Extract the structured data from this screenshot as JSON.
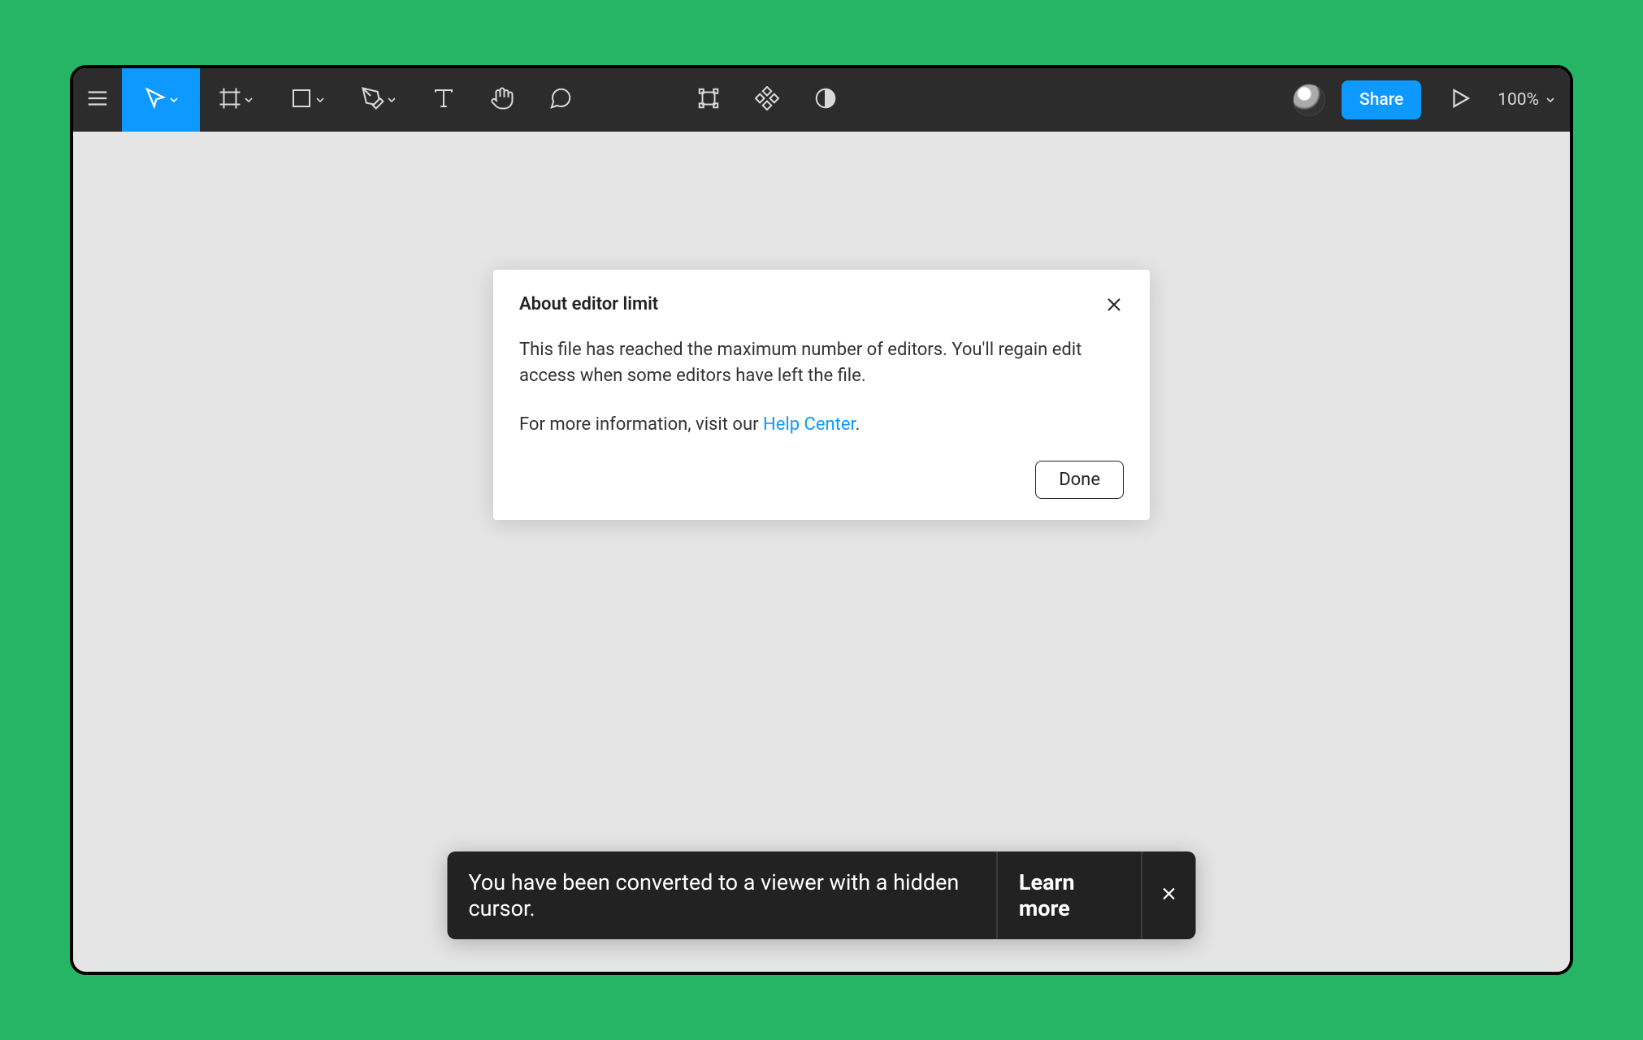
{
  "toolbar": {
    "share_label": "Share",
    "zoom_label": "100%"
  },
  "modal": {
    "title": "About editor limit",
    "body_line1": "This file has reached the maximum number of editors. You'll regain edit access when some editors have left the file.",
    "body_line2_prefix": "For more information, visit our ",
    "help_link_label": "Help Center",
    "body_line2_suffix": ".",
    "done_label": "Done"
  },
  "toast": {
    "message": "You have been converted to a viewer with a hidden cursor.",
    "action_label": "Learn more"
  }
}
